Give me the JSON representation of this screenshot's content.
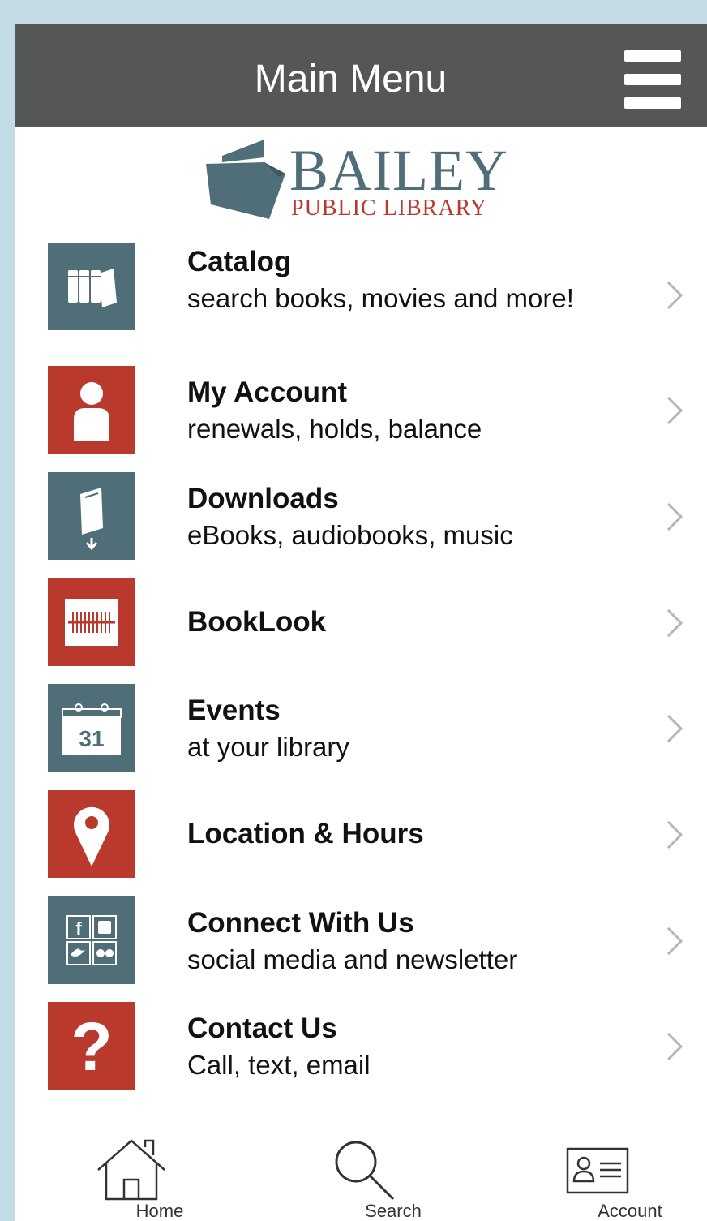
{
  "header": {
    "title": "Main Menu"
  },
  "logo": {
    "name": "BAILEY",
    "subtitle": "PUBLIC LIBRARY"
  },
  "colors": {
    "slate": "#4f6e78",
    "red": "#b93a2c",
    "header": "#555757"
  },
  "menu": [
    {
      "title": "Catalog",
      "subtitle": "search books, movies and more!",
      "icon": "books-icon"
    },
    {
      "title": "My Account",
      "subtitle": "renewals, holds, balance",
      "icon": "person-icon"
    },
    {
      "title": "Downloads",
      "subtitle": "eBooks, audiobooks, music",
      "icon": "book-download-icon"
    },
    {
      "title": "BookLook",
      "subtitle": "",
      "icon": "barcode-icon"
    },
    {
      "title": "Events",
      "subtitle": "at your library",
      "icon": "calendar-icon"
    },
    {
      "title": "Location & Hours",
      "subtitle": "",
      "icon": "map-pin-icon"
    },
    {
      "title": "Connect With Us",
      "subtitle": "social media and newsletter",
      "icon": "social-icon"
    },
    {
      "title": "Contact Us",
      "subtitle": "Call, text, email",
      "icon": "question-icon"
    }
  ],
  "calendar_day": "31",
  "tabbar": [
    {
      "label": "Home",
      "icon": "home-icon"
    },
    {
      "label": "Search",
      "icon": "search-icon"
    },
    {
      "label": "Account",
      "icon": "account-card-icon"
    }
  ]
}
